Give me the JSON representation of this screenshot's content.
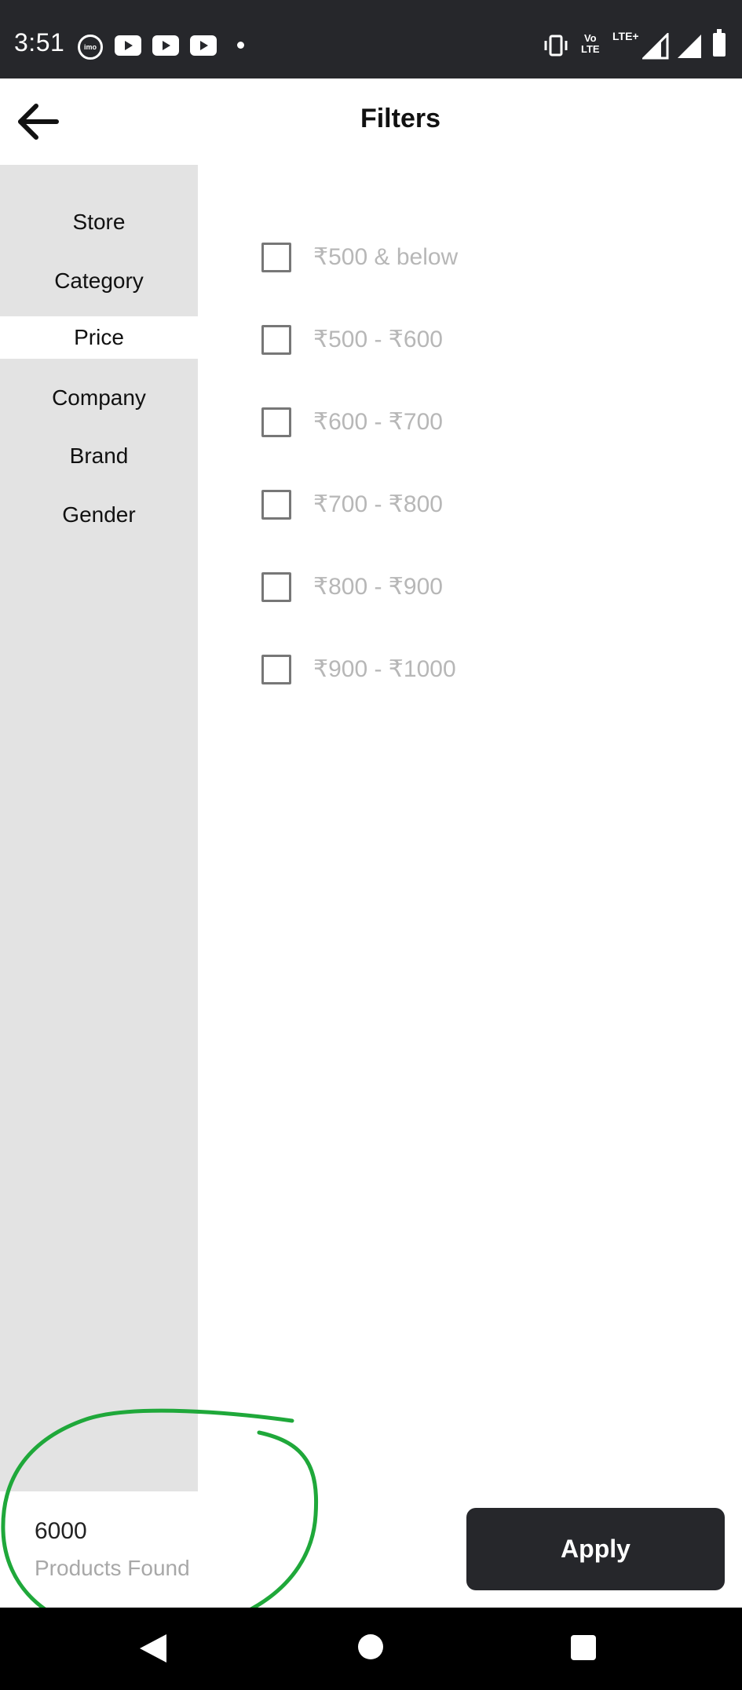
{
  "status_bar": {
    "time": "3:51",
    "imo_label": "imo",
    "volte_top": "Vo",
    "volte_bottom": "LTE",
    "network": "LTE+",
    "icons": [
      "imo-icon",
      "youtube-icon",
      "youtube-icon",
      "youtube-icon",
      "dot-icon",
      "vibrate-icon",
      "volte-icon",
      "lte-plus-icon",
      "signal-icon",
      "signal-icon",
      "battery-icon"
    ]
  },
  "header": {
    "title": "Filters",
    "back_icon": "arrow-left-icon"
  },
  "sidebar": {
    "items": [
      {
        "label": "Store",
        "active": false
      },
      {
        "label": "Category",
        "active": false
      },
      {
        "label": "Price",
        "active": true
      },
      {
        "label": "Company",
        "active": false
      },
      {
        "label": "Brand",
        "active": false
      },
      {
        "label": "Gender",
        "active": false
      }
    ]
  },
  "price_options": [
    {
      "label": "₹500 & below",
      "checked": false
    },
    {
      "label": "₹500 - ₹600",
      "checked": false
    },
    {
      "label": "₹600 - ₹700",
      "checked": false
    },
    {
      "label": "₹700 - ₹800",
      "checked": false
    },
    {
      "label": "₹800 - ₹900",
      "checked": false
    },
    {
      "label": "₹900 - ₹1000",
      "checked": false
    }
  ],
  "footer": {
    "count": "6000",
    "count_label": "Products Found",
    "apply_label": "Apply"
  },
  "colors": {
    "status_bar_bg": "#26272b",
    "sidebar_bg": "#e3e3e3",
    "apply_bg": "#26272b",
    "annotation": "#1fa83a"
  }
}
